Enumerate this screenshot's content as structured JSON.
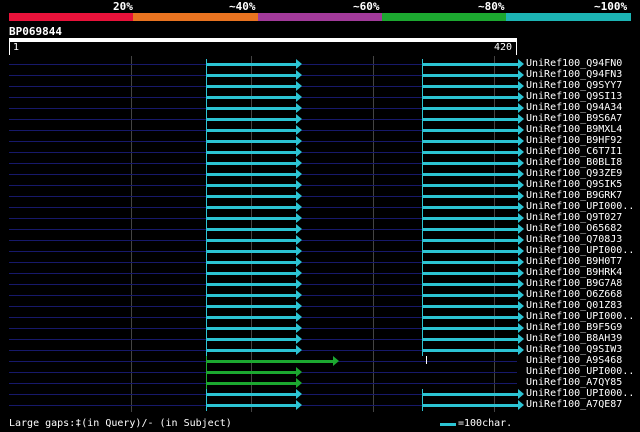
{
  "scale": {
    "labels": [
      "20%",
      "~40%",
      "~60%",
      "~80%",
      "~100%"
    ],
    "colors": [
      "#e8123a",
      "#e87320",
      "#a23a9a",
      "#1ca830",
      "#1cb4b4"
    ]
  },
  "query": {
    "name": "BP069844",
    "start": "1",
    "end": "420"
  },
  "hits": [
    {
      "name": "UniRef100_Q94FN0",
      "color": "#2cc4d4"
    },
    {
      "name": "UniRef100_Q94FN3",
      "color": "#2cc4d4"
    },
    {
      "name": "UniRef100_Q9SYY7",
      "color": "#2cc4d4"
    },
    {
      "name": "UniRef100_Q9SI13",
      "color": "#2cc4d4"
    },
    {
      "name": "UniRef100_Q94A34",
      "color": "#2cc4d4"
    },
    {
      "name": "UniRef100_B9S6A7",
      "color": "#2cc4d4"
    },
    {
      "name": "UniRef100_B9MXL4",
      "color": "#2cc4d4"
    },
    {
      "name": "UniRef100_B9HF92",
      "color": "#2cc4d4"
    },
    {
      "name": "UniRef100_C6T7I1",
      "color": "#2cc4d4"
    },
    {
      "name": "UniRef100_B0BLI8",
      "color": "#2cc4d4"
    },
    {
      "name": "UniRef100_Q93ZE9",
      "color": "#2cc4d4"
    },
    {
      "name": "UniRef100_Q9SIK5",
      "color": "#2cc4d4"
    },
    {
      "name": "UniRef100_B9GRK7",
      "color": "#2cc4d4"
    },
    {
      "name": "UniRef100_UPI000..",
      "color": "#2cc4d4"
    },
    {
      "name": "UniRef100_Q9T027",
      "color": "#2cc4d4"
    },
    {
      "name": "UniRef100_O65682",
      "color": "#2cc4d4"
    },
    {
      "name": "UniRef100_Q708J3",
      "color": "#2cc4d4"
    },
    {
      "name": "UniRef100_UPI000..",
      "color": "#2cc4d4"
    },
    {
      "name": "UniRef100_B9H0T7",
      "color": "#2cc4d4"
    },
    {
      "name": "UniRef100_B9HRK4",
      "color": "#2cc4d4"
    },
    {
      "name": "UniRef100_B9G7A8",
      "color": "#2cc4d4"
    },
    {
      "name": "UniRef100_O6Z668",
      "color": "#2cc4d4"
    },
    {
      "name": "UniRef100_Q01Z83",
      "color": "#2cc4d4"
    },
    {
      "name": "UniRef100_UPI000..",
      "color": "#2cc4d4"
    },
    {
      "name": "UniRef100_B9F5G9",
      "color": "#2cc4d4"
    },
    {
      "name": "UniRef100_B8AH39",
      "color": "#2cc4d4"
    },
    {
      "name": "UniRef100_Q9SIW3",
      "color": "#2cc4d4"
    },
    {
      "name": "UniRef100_A9S468",
      "color": "#1ca830"
    },
    {
      "name": "UniRef100_UPI000..",
      "color": "#1ca830"
    },
    {
      "name": "UniRef100_A7QY85",
      "color": "#1ca830"
    },
    {
      "name": "UniRef100_UPI000..",
      "color": "#2cc4d4"
    },
    {
      "name": "UniRef100_A7QE87",
      "color": "#2cc4d4"
    }
  ],
  "footer": {
    "text": "Large gaps:‡(in Query)/- (in Subject)"
  },
  "legend": {
    "text": "=100char."
  }
}
